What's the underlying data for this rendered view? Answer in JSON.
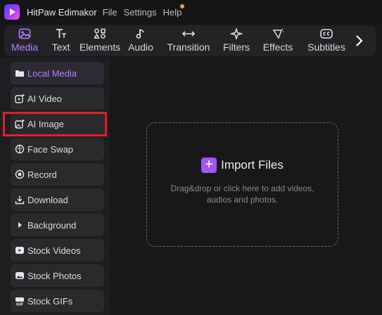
{
  "app": {
    "name": "HitPaw Edimakor",
    "logo_icon": "app-logo-icon"
  },
  "menu": [
    "File",
    "Settings",
    "Help"
  ],
  "tabs": [
    {
      "label": "Media",
      "icon": "media-icon",
      "active": true
    },
    {
      "label": "Text",
      "icon": "text-icon"
    },
    {
      "label": "Elements",
      "icon": "elements-icon"
    },
    {
      "label": "Audio",
      "icon": "audio-icon"
    },
    {
      "label": "Transition",
      "icon": "transition-icon"
    },
    {
      "label": "Filters",
      "icon": "filters-icon"
    },
    {
      "label": "Effects",
      "icon": "effects-icon"
    },
    {
      "label": "Subtitles",
      "icon": "subtitles-icon"
    }
  ],
  "sidebar": {
    "items": [
      {
        "label": "Local Media",
        "icon": "folder-icon",
        "active": true
      },
      {
        "label": "AI Video",
        "icon": "ai-video-icon"
      },
      {
        "label": "AI Image",
        "icon": "ai-image-icon",
        "highlighted": true
      },
      {
        "label": "Face Swap",
        "icon": "face-swap-icon"
      },
      {
        "label": "Record",
        "icon": "record-icon"
      },
      {
        "label": "Download",
        "icon": "download-icon"
      },
      {
        "label": "Background",
        "icon": "play-triangle-icon"
      },
      {
        "label": "Stock Videos",
        "icon": "stock-videos-icon"
      },
      {
        "label": "Stock Photos",
        "icon": "stock-photos-icon"
      },
      {
        "label": "Stock GIFs",
        "icon": "gif-icon"
      }
    ]
  },
  "import": {
    "label": "Import Files",
    "hint": "Drag&drop or click here to add videos, audios and photos."
  },
  "colors": {
    "accent": "#b680ff",
    "highlight_box": "#e0202a",
    "import_button": "#a056f0"
  }
}
